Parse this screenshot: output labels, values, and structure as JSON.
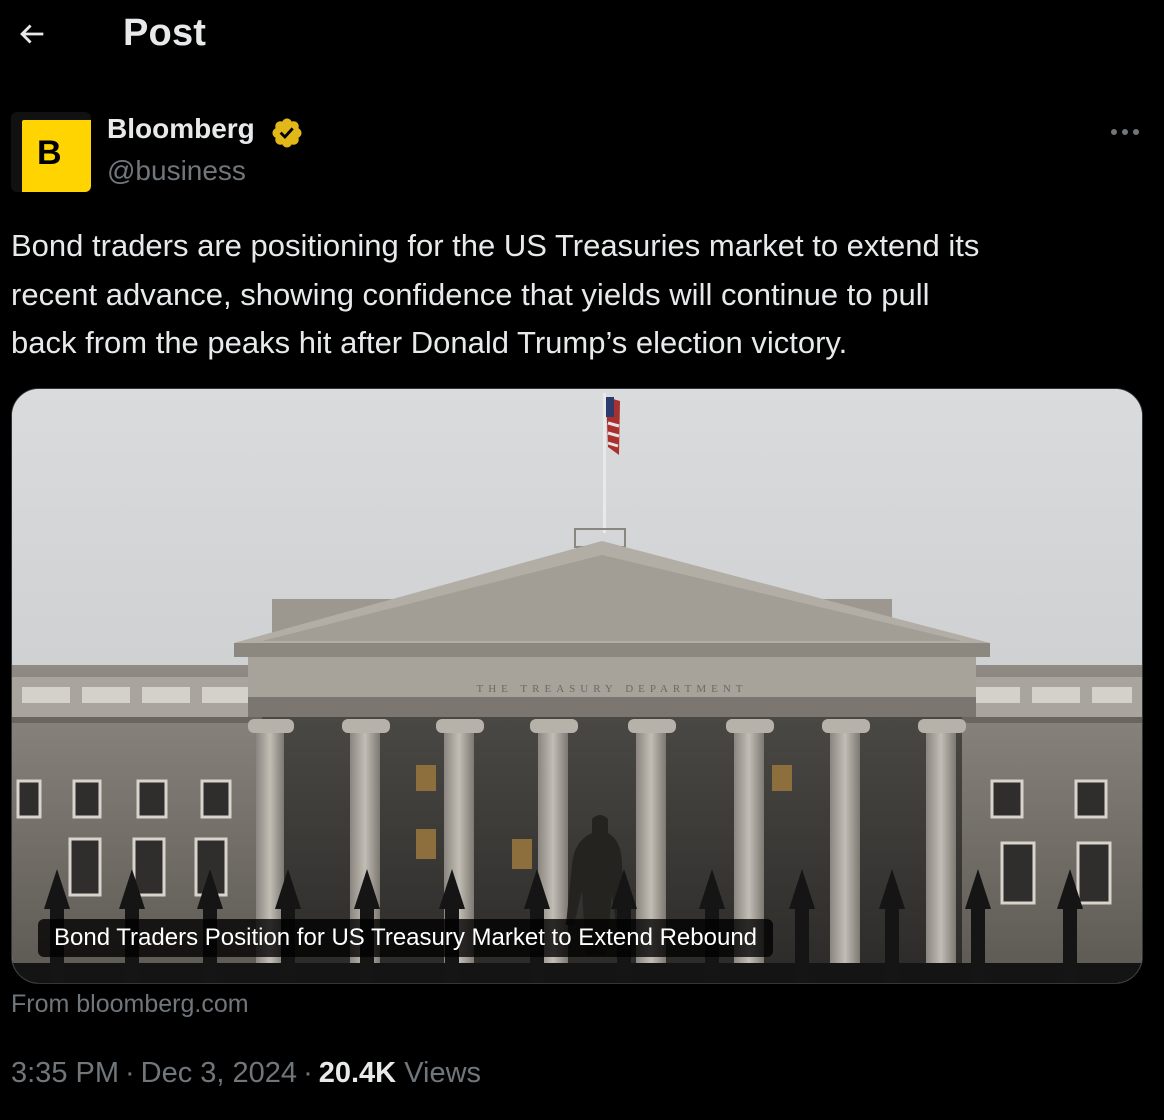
{
  "header": {
    "title": "Post"
  },
  "author": {
    "name": "Bloomberg",
    "handle": "@business",
    "avatar_letter": "B"
  },
  "post": {
    "text": "Bond traders are positioning for the US Treasuries market to extend its\nrecent advance, showing confidence that yields will continue to pull\nback from the peaks hit after Donald Trump’s election victory."
  },
  "card": {
    "caption": "Bond Traders Position for US Treasury Market to Extend Rebound",
    "source": "From bloomberg.com",
    "engraving": "THE TREASURY DEPARTMENT"
  },
  "meta": {
    "time": "3:35 PM",
    "separator": "·",
    "date": "Dec 3, 2024",
    "views_count": "20.4K",
    "views_label": "Views"
  },
  "colors": {
    "accent_verified": "#e2b719",
    "brand_yellow": "#ffd400",
    "muted": "#71767b",
    "background": "#000000"
  }
}
